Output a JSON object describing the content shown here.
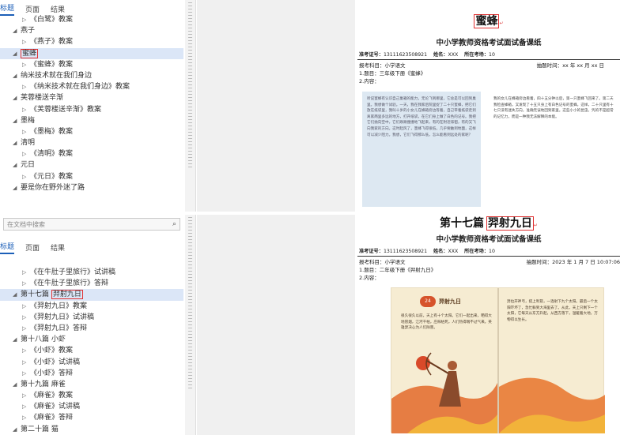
{
  "nav_tabs": [
    "标题",
    "页面",
    "结果"
  ],
  "search_placeholder": "在文档中搜索",
  "search_icon_glyph": "⌕",
  "top_tree": [
    {
      "text": "《白鹭》教案",
      "level": 2,
      "arrow": "▷"
    },
    {
      "text": "燕子",
      "level": 1,
      "arrow": "◢"
    },
    {
      "text": "《燕子》教案",
      "level": 2,
      "arrow": "▷"
    },
    {
      "text": "蜜蜂",
      "level": 1,
      "arrow": "◢",
      "selected": true,
      "highlight": true
    },
    {
      "text": "《蜜蜂》教案",
      "level": 2,
      "arrow": "▷"
    },
    {
      "text": "纳米技术就在我们身边",
      "level": 1,
      "arrow": "◢"
    },
    {
      "text": "《纳米技术就在我们身边》教案",
      "level": 2,
      "arrow": "▷"
    },
    {
      "text": "芙蓉楼送辛渐",
      "level": 1,
      "arrow": "◢"
    },
    {
      "text": "《芙蓉楼送辛渐》教案",
      "level": 2,
      "arrow": "▷"
    },
    {
      "text": "墨梅",
      "level": 1,
      "arrow": "◢"
    },
    {
      "text": "《墨梅》教案",
      "level": 2,
      "arrow": "▷"
    },
    {
      "text": "清明",
      "level": 1,
      "arrow": "◢"
    },
    {
      "text": "《清明》教案",
      "level": 2,
      "arrow": "▷"
    },
    {
      "text": "元日",
      "level": 1,
      "arrow": "◢"
    },
    {
      "text": "《元日》教案",
      "level": 2,
      "arrow": "▷"
    },
    {
      "text": "要是你在野外迷了路",
      "level": 1,
      "arrow": "◢"
    }
  ],
  "bottom_tree": [
    {
      "text": "《在牛肚子里旅行》试讲稿",
      "level": 2,
      "arrow": "▷"
    },
    {
      "text": "《在牛肚子里旅行》答辩",
      "level": 2,
      "arrow": "▷"
    },
    {
      "prefix": "第十七篇",
      "text": "羿射九日",
      "level": 1,
      "arrow": "◢",
      "selected": true,
      "highlight": true
    },
    {
      "text": "《羿射九日》教案",
      "level": 2,
      "arrow": "▷"
    },
    {
      "text": "《羿射九日》试讲稿",
      "level": 2,
      "arrow": "▷"
    },
    {
      "text": "《羿射九日》答辩",
      "level": 2,
      "arrow": "▷"
    },
    {
      "text": "第十八篇 小虾",
      "level": 1,
      "arrow": "◢"
    },
    {
      "text": "《小虾》教案",
      "level": 2,
      "arrow": "▷"
    },
    {
      "text": "《小虾》试讲稿",
      "level": 2,
      "arrow": "▷"
    },
    {
      "text": "《小虾》答辩",
      "level": 2,
      "arrow": "▷"
    },
    {
      "text": "第十九篇 麻雀",
      "level": 1,
      "arrow": "◢"
    },
    {
      "text": "《麻雀》教案",
      "level": 2,
      "arrow": "▷"
    },
    {
      "text": "《麻雀》试讲稿",
      "level": 2,
      "arrow": "▷"
    },
    {
      "text": "《麻雀》答辩",
      "level": 2,
      "arrow": "▷"
    },
    {
      "text": "第二十篇 猫",
      "level": 1,
      "arrow": "◢"
    }
  ],
  "doc1": {
    "title": "蜜蜂",
    "subtitle": "中小学教师资格考试面试备课纸",
    "meta_label1": "准考证号：",
    "meta_val1": "13111623508921",
    "meta_label2": "姓名：",
    "meta_val2": "XXX",
    "meta_label3": "所在考场：",
    "meta_val3": "10",
    "subject": "报考科目：小学语文",
    "time": "抽题时间：xx 年 xx 月 xx 日",
    "q1": "1.题目：三年级下册《蜜蜂》",
    "q2": "2.内容：",
    "text_left": "听说蜜蜂有认识自己巢箱的能力，无论飞到哪里，它总是可以回到巢里。我想做个试验。一天，我在我家后院里捉了二十只蜜蜂，把它们放在纸袋里，我叫十岁的小女儿在蜂箱旁边等着，自己带着纸袋走到离家两里多远的地方，打开纸袋，在它们身上做了白色的记号。我把它们抛向空中，它们跌跌撞撞地飞起来，有的在附近徘徊，有的又飞向我家的方向。这时起风了，蜜蜂飞得很低，几乎要触到地面，这样可以减少阻力。我想，它们飞得那么低，怎么能看到远处的家呢？",
    "text_right": "我的女儿在蜂箱旁边看着，四十五分钟以后，第一只蜜蜂飞回来了。第二天我检查蜂箱，又发现了十五只身上有白色记号的蜜蜂。这样，二十只里有十七只没有迷失方向，准确无误地回到家里。这些小小的昆虫，凭的不是超常的记忆力，而是一种我无法解释的本能。"
  },
  "doc2": {
    "prefix": "第十七篇",
    "title": "羿射九日",
    "subtitle": "中小学教师资格考试面试备课纸",
    "meta_label1": "准考证号：",
    "meta_val1": "13111623508921",
    "meta_label2": "姓名：",
    "meta_val2": "XXX",
    "meta_label3": "所在考场：",
    "meta_val3": "10",
    "subject": "报考科目：小学语文",
    "time": "抽题时间：2023 年 1 月 7 日 10:07:06",
    "q1": "1.题目：二年级下册《羿射九日》",
    "q2": "2.内容：",
    "book_title": "羿射九日",
    "book_number": "24",
    "text_left": "很久很久以前，天上有十个太阳。它们一起出来，晒得大地冒烟，江河干枯，庄稼枯死，人们热得喘不过气来。英雄羿决心为人们除害。",
    "text_right": "羿拉开神弓，搭上利箭，一连射下九个太阳。最后一个太阳吓坏了，急忙躲到大海里去了。从此，天上只剩下一个太阳，它每天从东方升起，从西方落下，温暖着大地，万物得以生长。"
  },
  "colors": {
    "accent": "#1c5fb8",
    "highlight_box": "#e03030",
    "selected_row": "#dbe6f7"
  }
}
